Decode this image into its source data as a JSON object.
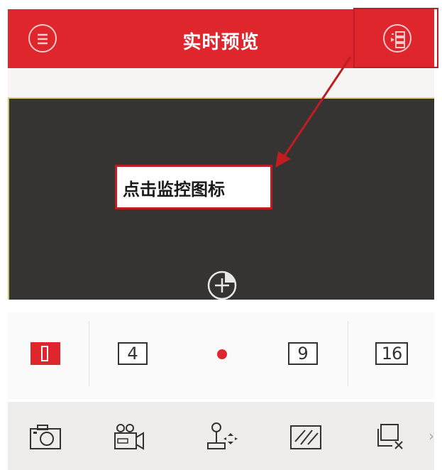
{
  "header": {
    "title": "实时预览",
    "menu_icon": "menu-icon",
    "device_list_icon": "device-list-icon",
    "bg_color": "#e0262d"
  },
  "annotation": {
    "callout_text": "点击监控图标",
    "color": "#c01d22"
  },
  "video": {
    "add_icon": "add-channel-icon"
  },
  "split_modes": [
    {
      "label": "",
      "active": true
    },
    {
      "label": "4",
      "active": false
    },
    {
      "label": "9",
      "active": false
    },
    {
      "label": "16",
      "active": false
    }
  ],
  "page_indicator": {
    "color": "#e0262d"
  },
  "toolbar": {
    "tools": [
      "camera-icon",
      "record-icon",
      "ptz-icon",
      "image-quality-icon",
      "close-window-icon"
    ],
    "more": "›"
  }
}
